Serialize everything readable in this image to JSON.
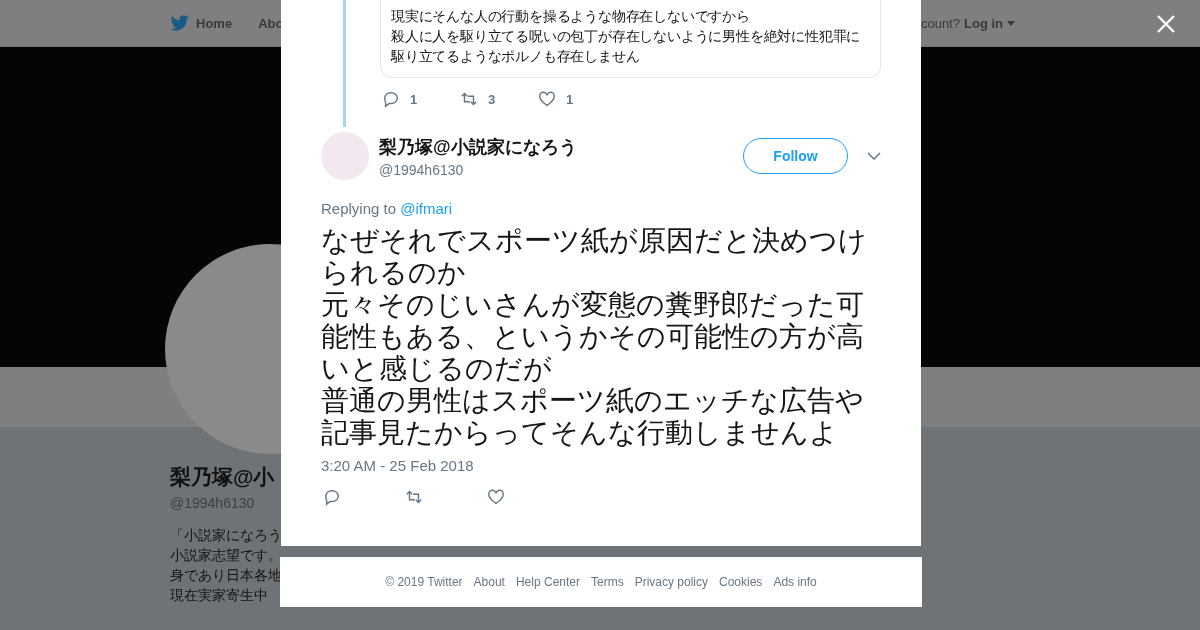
{
  "background": {
    "nav": [
      {
        "kind": "home",
        "label": "Home"
      },
      {
        "kind": "text",
        "label": "Abo"
      }
    ],
    "login": {
      "prompt": "count?",
      "label": "Log in"
    },
    "profile": {
      "name": "梨乃塚@小",
      "handle": "@1994h6130",
      "bio": [
        "「小説家になろう",
        "小説家志望です。",
        "身であり日本各地",
        "現在実家寄生中"
      ]
    }
  },
  "modal": {
    "quoted": {
      "lines": [
        "現実にそんな人の行動を操るような物存在しないですから",
        "殺人に人を駆り立てる呪いの包丁が存在しないように男性を絶対に性犯罪に",
        "駆り立てるようなポルノも存在しません"
      ],
      "actions": [
        {
          "kind": "reply",
          "count": "1"
        },
        {
          "kind": "retweet",
          "count": "3"
        },
        {
          "kind": "like",
          "count": "1"
        }
      ]
    },
    "tweet": {
      "name": "梨乃塚@小説家になろう",
      "handle": "@1994h6130",
      "follow": "Follow",
      "replying_prefix": "Replying to",
      "replying_to": "@ifmari",
      "text": [
        "なぜそれでスポーツ紙が原因だと決めつけられるのか",
        "元々そのじいさんが変態の糞野郎だった可能性もある、というかその可能性の方が高いと感じるのだが",
        "普通の男性はスポーツ紙のエッチな広告や記事見たからってそんな行動しませんよ"
      ],
      "time": "3:20 AM - 25 Feb 2018",
      "actions": [
        {
          "kind": "reply"
        },
        {
          "kind": "retweet"
        },
        {
          "kind": "like"
        }
      ]
    }
  },
  "footer": [
    "© 2019 Twitter",
    "About",
    "Help Center",
    "Terms",
    "Privacy policy",
    "Cookies",
    "Ads info"
  ]
}
